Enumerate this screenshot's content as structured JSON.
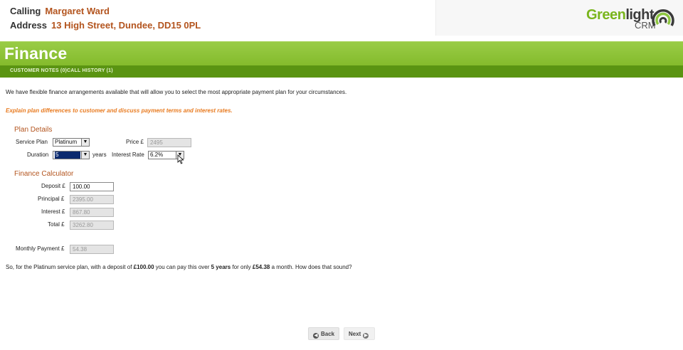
{
  "header": {
    "calling_label": "Calling",
    "calling_value": "Margaret Ward",
    "address_label": "Address",
    "address_value": "13 High Street, Dundee, DD15 0PL",
    "logo_green": "Green",
    "logo_dark": "light",
    "logo_sub": "CRM"
  },
  "page": {
    "title": "Finance"
  },
  "nav": {
    "customer_notes": "CUSTOMER NOTES (0)",
    "call_history": "CALL HISTORY (1)"
  },
  "content": {
    "intro": "We have flexible finance arrangements available that will allow you to select the most appropriate payment plan for your circumstances.",
    "instruction": "Explain plan differences to customer and discuss payment terms and interest rates."
  },
  "plan_details": {
    "title": "Plan Details",
    "service_plan_label": "Service Plan",
    "service_plan_value": "Platinum",
    "price_label": "Price £",
    "price_value": "2495",
    "duration_label": "Duration",
    "duration_value": "5",
    "years_label": "years",
    "interest_rate_label": "Interest Rate",
    "interest_rate_value": "6.2%"
  },
  "calculator": {
    "title": "Finance Calculator",
    "deposit_label": "Deposit £",
    "deposit_value": "100.00",
    "principal_label": "Principal £",
    "principal_value": "2395.00",
    "interest_label": "Interest £",
    "interest_value": "867.80",
    "total_label": "Total £",
    "total_value": "3262.80",
    "monthly_label": "Monthly Payment £",
    "monthly_value": "54.38"
  },
  "summary": {
    "part1": "So, for the Platinum service plan, with a deposit of ",
    "deposit": "£100.00",
    "part2": " you can pay this over ",
    "years": "5 years",
    "part3": " for only ",
    "monthly": "£54.38",
    "part4": " a month. How does that sound?"
  },
  "footer": {
    "back_label": "Back",
    "next_label": "Next"
  },
  "colors": {
    "brand_green": "#8dc63f",
    "nav_green": "#5a9412",
    "accent_orange": "#e87a1f",
    "accent_brown": "#b3541e"
  }
}
